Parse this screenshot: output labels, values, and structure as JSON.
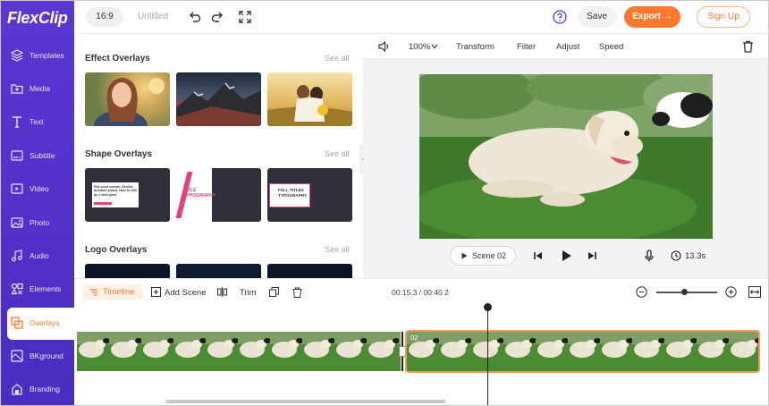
{
  "app": {
    "logo": "FlexClip"
  },
  "topbar": {
    "ratio": "16:9",
    "title": "Untitled",
    "save_label": "Save",
    "export_label": "Export →",
    "signup_label": "Sign Up"
  },
  "sidebar": {
    "items": [
      {
        "label": "Templates",
        "icon": "layers-icon"
      },
      {
        "label": "Media",
        "icon": "folder-plus-icon"
      },
      {
        "label": "Text",
        "icon": "text-icon"
      },
      {
        "label": "Subtitle",
        "icon": "subtitle-icon"
      },
      {
        "label": "Video",
        "icon": "video-icon"
      },
      {
        "label": "Photo",
        "icon": "photo-icon"
      },
      {
        "label": "Audio",
        "icon": "music-icon"
      },
      {
        "label": "Elements",
        "icon": "elements-icon"
      },
      {
        "label": "Overlays",
        "icon": "overlays-icon"
      },
      {
        "label": "BKground",
        "icon": "background-icon"
      },
      {
        "label": "Branding",
        "icon": "branding-icon"
      }
    ],
    "active": "Overlays"
  },
  "panel": {
    "sections": [
      {
        "title": "Effect Overlays",
        "see_all": "See all"
      },
      {
        "title": "Shape Overlays",
        "see_all": "See all"
      },
      {
        "title": "Logo Overlays",
        "see_all": "See all"
      }
    ],
    "shape_thumbs": [
      {
        "text": "Full color control, flexible duration adjust, ease to edit by 1 click pack"
      },
      {
        "text": "TITLE TYPOGRAPHY"
      },
      {
        "text": "FULL TITLES TYPOGRAPHY"
      }
    ]
  },
  "preview_toolbar": {
    "zoom": "100%",
    "transform": "Transform",
    "filter": "Filter",
    "adjust": "Adjust",
    "speed": "Speed"
  },
  "preview": {
    "scene_label": "Scene 02",
    "duration": "13.3s"
  },
  "timeline": {
    "tab_label": "Timeline",
    "add_scene": "Add Scene",
    "trim": "Trim",
    "timecode": "00:15.3 / 00:40.2",
    "clip_number": "02",
    "zoom_level": 0.47
  },
  "colors": {
    "brand": "#5b37d3",
    "accent": "#ff7a2f"
  }
}
